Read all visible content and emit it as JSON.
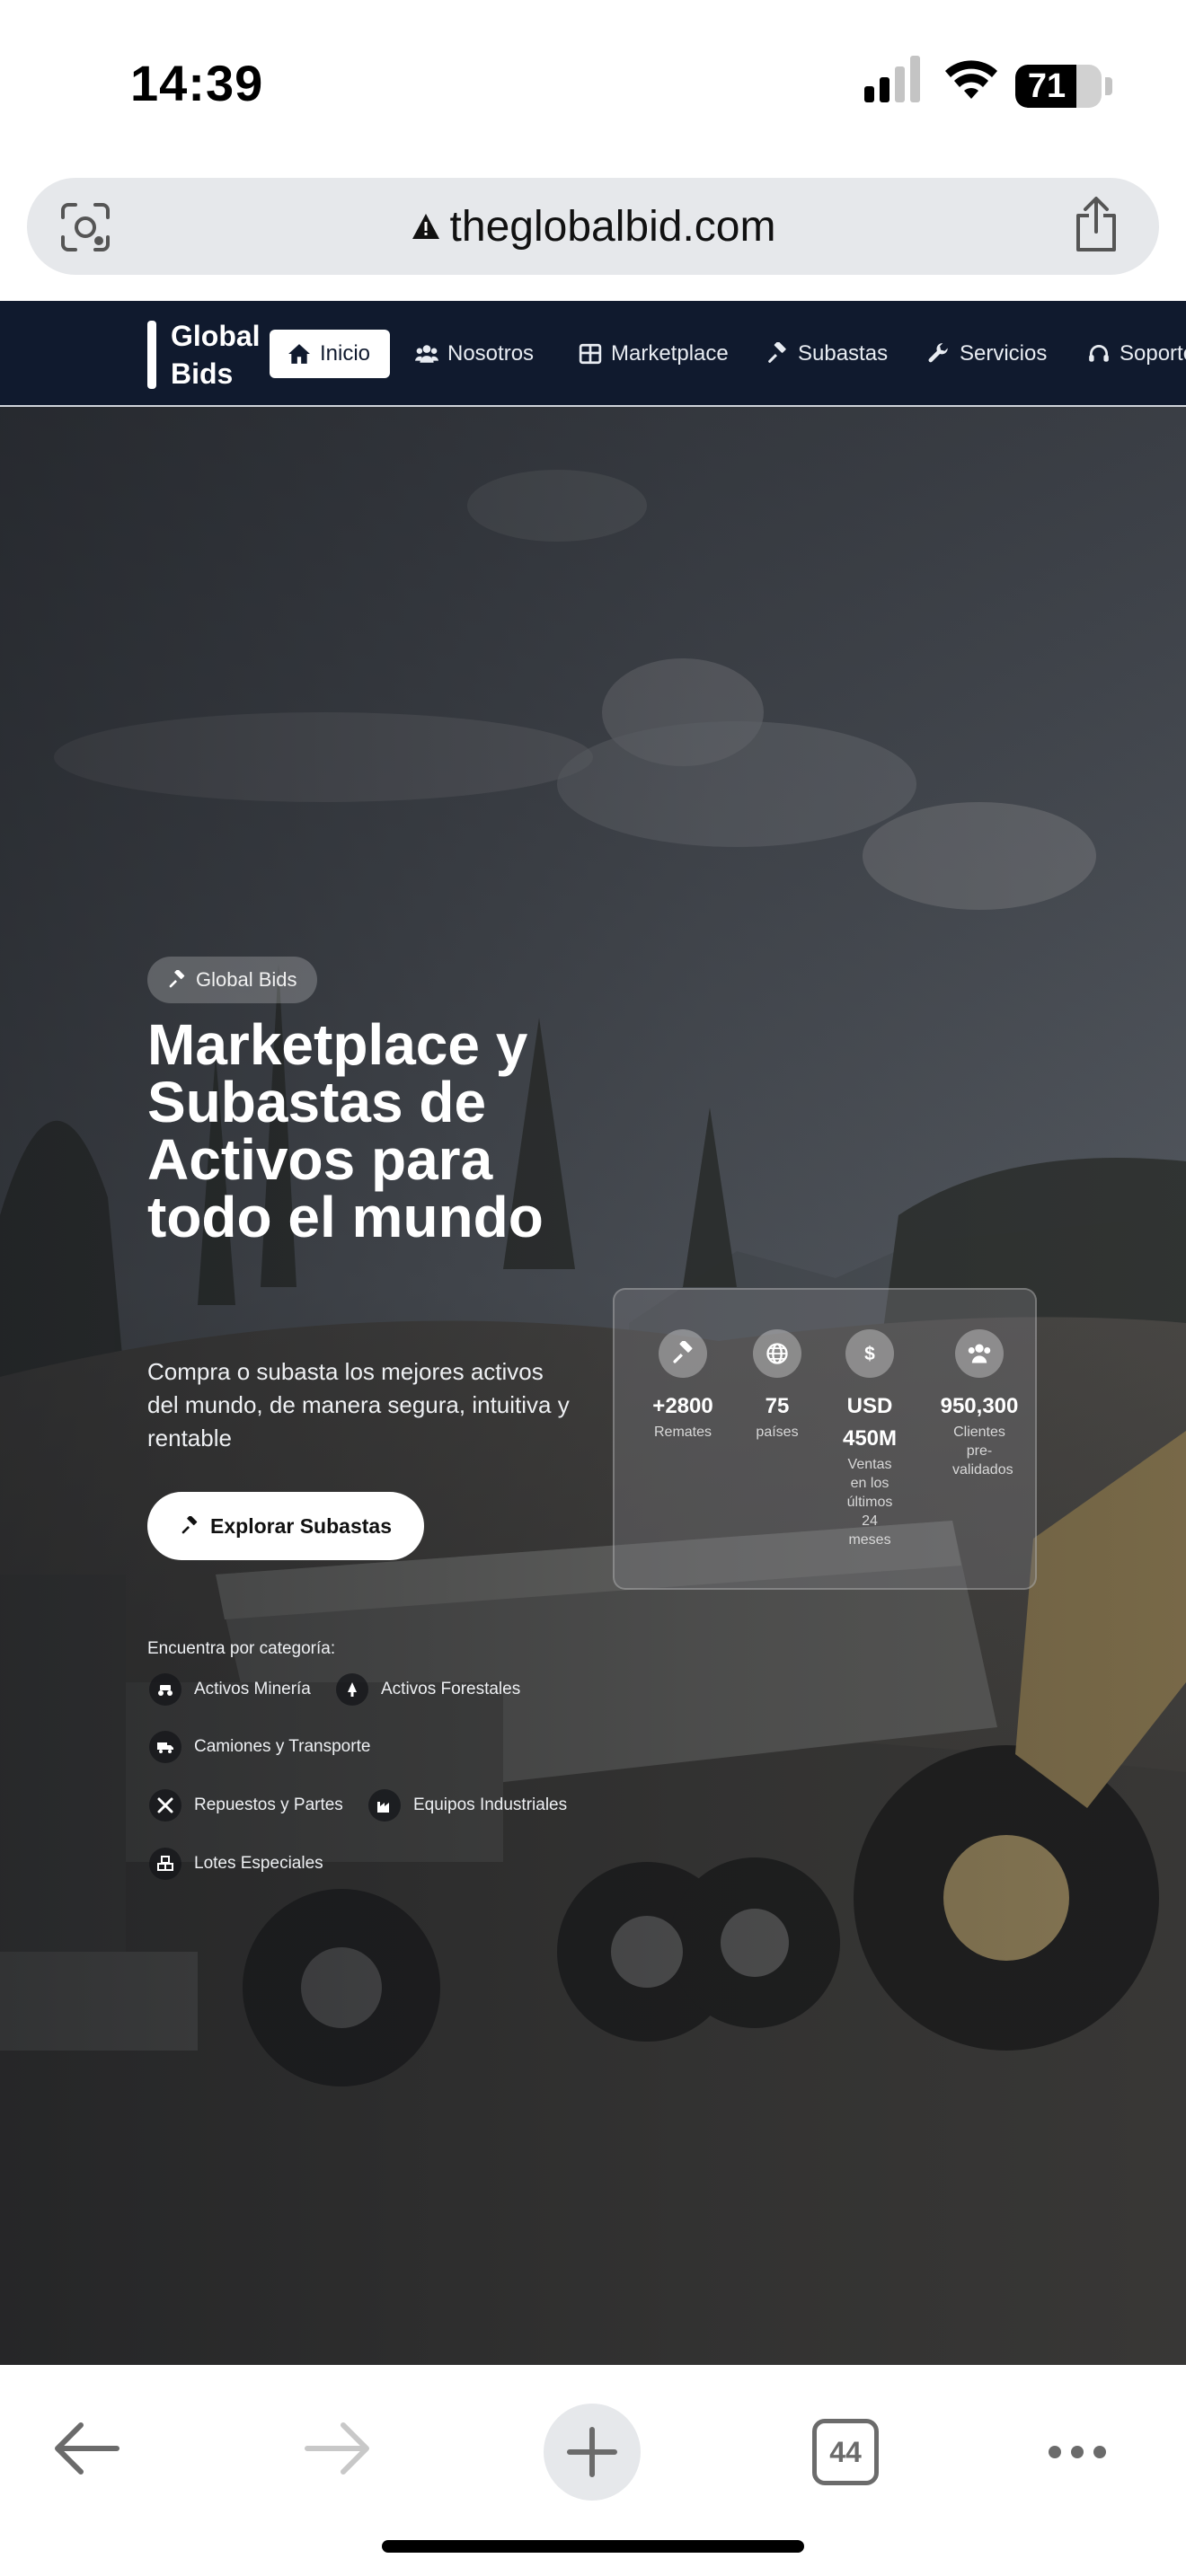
{
  "status_bar": {
    "time": "14:39",
    "battery": "71",
    "battery_level": 0.71
  },
  "browser": {
    "url": "theglobalbid.com"
  },
  "site": {
    "logo": {
      "line1": "Global",
      "line2": "Bids"
    },
    "nav": [
      {
        "label": "Inicio",
        "icon": "home-icon"
      },
      {
        "label": "Nosotros",
        "icon": "users-icon"
      },
      {
        "label": "Marketplace",
        "icon": "grid-icon"
      },
      {
        "label": "Subastas",
        "icon": "gavel-icon"
      },
      {
        "label": "Servicios",
        "icon": "wrench-icon"
      },
      {
        "label": "Soporte",
        "icon": "headset-icon"
      }
    ],
    "hero": {
      "tag": "Global Bids",
      "title": "Marketplace y Subastas de Activos para todo el mundo",
      "subtitle": "Compra o subasta los mejores activos del mundo, de manera segura, intuitiva y rentable",
      "cta": "Explorar Subastas",
      "categories_title": "Encuentra por categoría:",
      "categories": [
        {
          "label": "Activos Minería",
          "icon": "excavator-icon"
        },
        {
          "label": "Activos Forestales",
          "icon": "tree-icon"
        },
        {
          "label": "Camiones y Transporte",
          "icon": "truck-icon"
        },
        {
          "label": "Repuestos y Partes",
          "icon": "tools-icon"
        },
        {
          "label": "Equipos Industriales",
          "icon": "factory-icon"
        },
        {
          "label": "Lotes Especiales",
          "icon": "boxes-icon"
        }
      ],
      "stats": [
        {
          "value": "+2800",
          "label": "Remates",
          "icon": "gavel-icon"
        },
        {
          "value": "75",
          "label": "países",
          "icon": "globe-icon"
        },
        {
          "value": "USD 450M",
          "label": "Ventas en los últimos 24 meses",
          "icon": "dollar-icon"
        },
        {
          "value": "950,300",
          "label": "Clientes pre-validados",
          "icon": "users-icon"
        }
      ]
    }
  },
  "toolbar": {
    "tabs_count": "44"
  }
}
